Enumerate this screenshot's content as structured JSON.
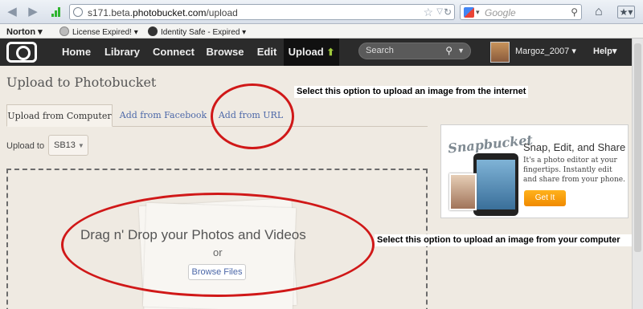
{
  "browser": {
    "url_prefix": "s171.beta.",
    "url_domain": "photobucket.com",
    "url_path": "/upload",
    "search_placeholder": "Google"
  },
  "toolbar": {
    "norton": "Norton",
    "license": "License Expired!",
    "identity": "Identity Safe - Expired"
  },
  "site": {
    "nav": [
      "Home",
      "Library",
      "Connect",
      "Browse",
      "Edit",
      "Upload"
    ],
    "search_placeholder": "Search",
    "username": "Margoz_2007",
    "help": "Help"
  },
  "page": {
    "title": "Upload to Photobucket",
    "tabs": [
      "Upload from Computer",
      "Add from Facebook",
      "Add from URL"
    ],
    "upload_to_label": "Upload to",
    "album": "SB13",
    "drag_text": "Drag n' Drop your Photos and Videos",
    "or_text": "or",
    "browse_label": "Browse Files"
  },
  "ad": {
    "brand": "Snapbucket",
    "headline": "Snap, Edit, and Share",
    "body": "It's a photo editor at your fingertips. Instantly edit and share from your phone.",
    "cta": "Get It"
  },
  "annotations": {
    "url_note": "Select this option to upload an image from the internet",
    "computer_note": "Select this option to upload an image from your computer"
  },
  "colors": {
    "annotation_red": "#d01818",
    "upload_arrow": "#9ec83b",
    "link_blue": "#4b67a8",
    "get_it_orange": "#f08a00"
  }
}
